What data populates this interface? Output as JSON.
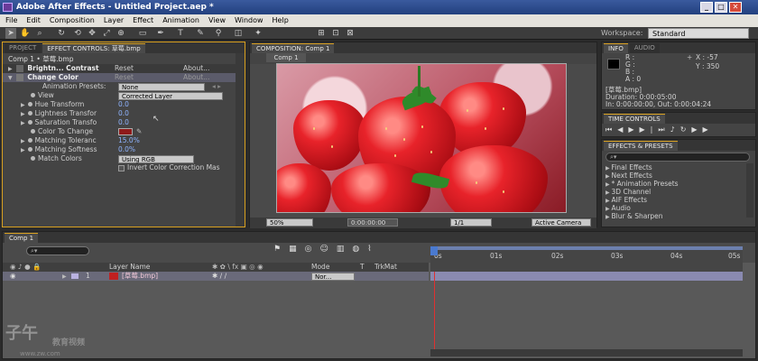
{
  "window": {
    "title": "Adobe After Effects - Untitled Project.aep *",
    "min": "_",
    "max": "□",
    "close": "✕"
  },
  "menu": [
    "File",
    "Edit",
    "Composition",
    "Layer",
    "Effect",
    "Animation",
    "View",
    "Window",
    "Help"
  ],
  "toolbar": {
    "workspace_label": "Workspace:",
    "workspace_value": "Standard"
  },
  "left_panel": {
    "tabs": [
      "PROJECT",
      "EFFECT CONTROLS: 草莓.bmp"
    ],
    "breadcrumb": "Comp 1 • 草莓.bmp",
    "effects": [
      {
        "name": "Brightn... Contrast",
        "reset": "Reset",
        "about": "About..."
      },
      {
        "name": "Change Color",
        "reset": "Reset",
        "about": "About..."
      }
    ],
    "presets_label": "Animation Presets:",
    "presets_value": "None",
    "properties": [
      {
        "label": "View",
        "value": "Corrected Layer",
        "kind": "dropdown"
      },
      {
        "label": "Hue Transform",
        "value": "0.0",
        "kind": "number"
      },
      {
        "label": "Lightness Transfor",
        "value": "0.0",
        "kind": "number"
      },
      {
        "label": "Saturation Transfo",
        "value": "0.0",
        "kind": "number"
      },
      {
        "label": "Color To Change",
        "value": "",
        "kind": "color"
      },
      {
        "label": "Matching Toleranc",
        "value": "15.0%",
        "kind": "number"
      },
      {
        "label": "Matching Softness",
        "value": "0.0%",
        "kind": "number"
      },
      {
        "label": "Match Colors",
        "value": "Using RGB",
        "kind": "dropdown"
      }
    ],
    "invert_label": "Invert Color Correction Mas",
    "swatch_color": "#8f1a1a"
  },
  "comp_panel": {
    "tab": "COMPOSITION: Comp 1",
    "subtab": "Comp 1",
    "zoom": "50%",
    "timecode": "0:00:00:00",
    "resolution": "1/1",
    "camera": "Active Camera"
  },
  "info_panel": {
    "tabs": [
      "INFO",
      "AUDIO"
    ],
    "r": "R :",
    "g": "G :",
    "b": "B :",
    "a": "A : 0",
    "x": "X : -57",
    "y": "Y : 350",
    "file": "[草莓.bmp]",
    "duration": "Duration: 0:00:05:00",
    "inout": "In: 0:00:00:00, Out: 0:00:04:24"
  },
  "time_controls": {
    "tab": "TIME CONTROLS"
  },
  "effects_presets": {
    "tab": "EFFECTS & PRESETS",
    "search_placeholder": "",
    "items": [
      "Final Effects",
      "Next Effects",
      "* Animation Presets",
      "3D Channel",
      "AIF Effects",
      "Audio",
      "Blur & Sharpen"
    ]
  },
  "timeline": {
    "tab": "Comp 1",
    "columns": {
      "layer_name": "Layer Name",
      "mode": "Mode",
      "t": "T",
      "trkmat": "TrkMat"
    },
    "ruler": [
      "0s",
      "01s",
      "02s",
      "03s",
      "04s",
      "05s"
    ],
    "layers": [
      {
        "num": "1",
        "name": "[草莓.bmp]",
        "mode": "Nor..."
      }
    ]
  },
  "watermark": {
    "logo": "子午",
    "site": "教育视频",
    "url": "www.zw.com"
  }
}
